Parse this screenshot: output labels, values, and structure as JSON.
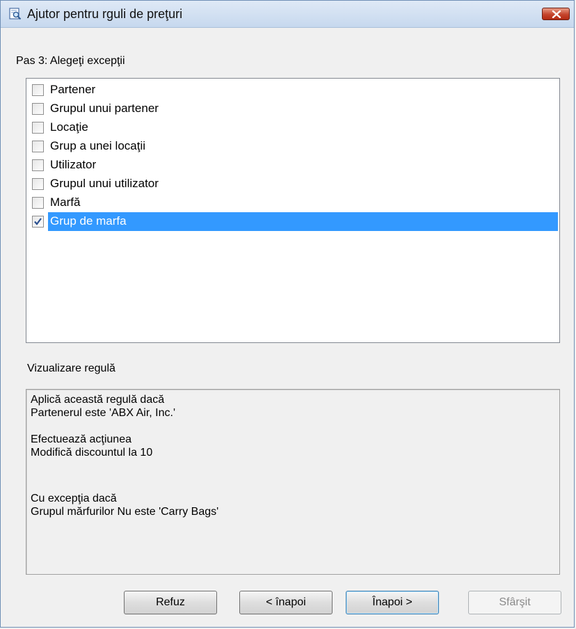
{
  "window": {
    "title": "Ajutor pentru rguli de preţuri",
    "close_icon": "close-icon"
  },
  "step_label": "Pas 3: Alegeţi excepţii",
  "exceptions": [
    {
      "label": "Partener",
      "checked": false
    },
    {
      "label": "Grupul unui partener",
      "checked": false
    },
    {
      "label": "Locaţie",
      "checked": false
    },
    {
      "label": "Grup a unei locaţii",
      "checked": false
    },
    {
      "label": "Utilizator",
      "checked": false
    },
    {
      "label": "Grupul unui utilizator",
      "checked": false
    },
    {
      "label": "Marfă",
      "checked": false
    },
    {
      "label": "Grup de marfa",
      "checked": true,
      "selected": true
    }
  ],
  "preview": {
    "label": "Vizualizare regulă",
    "lines": [
      "Aplică această regulă dacă",
      "Partenerul  este 'ABX Air, Inc.'",
      "",
      "Efectuează acţiunea",
      "Modifică discountul la 10",
      "",
      "Cu excepţia dacă",
      "Grupul mărfurilor Nu este 'Carry Bags'"
    ]
  },
  "buttons": {
    "cancel": "Refuz",
    "back": "< înapoi",
    "next": "Înapoi >",
    "finish": "Sfârşit"
  },
  "colors": {
    "selection": "#3399ff",
    "close_button": "#c5442c",
    "titlebar": "#c6d8ee"
  }
}
